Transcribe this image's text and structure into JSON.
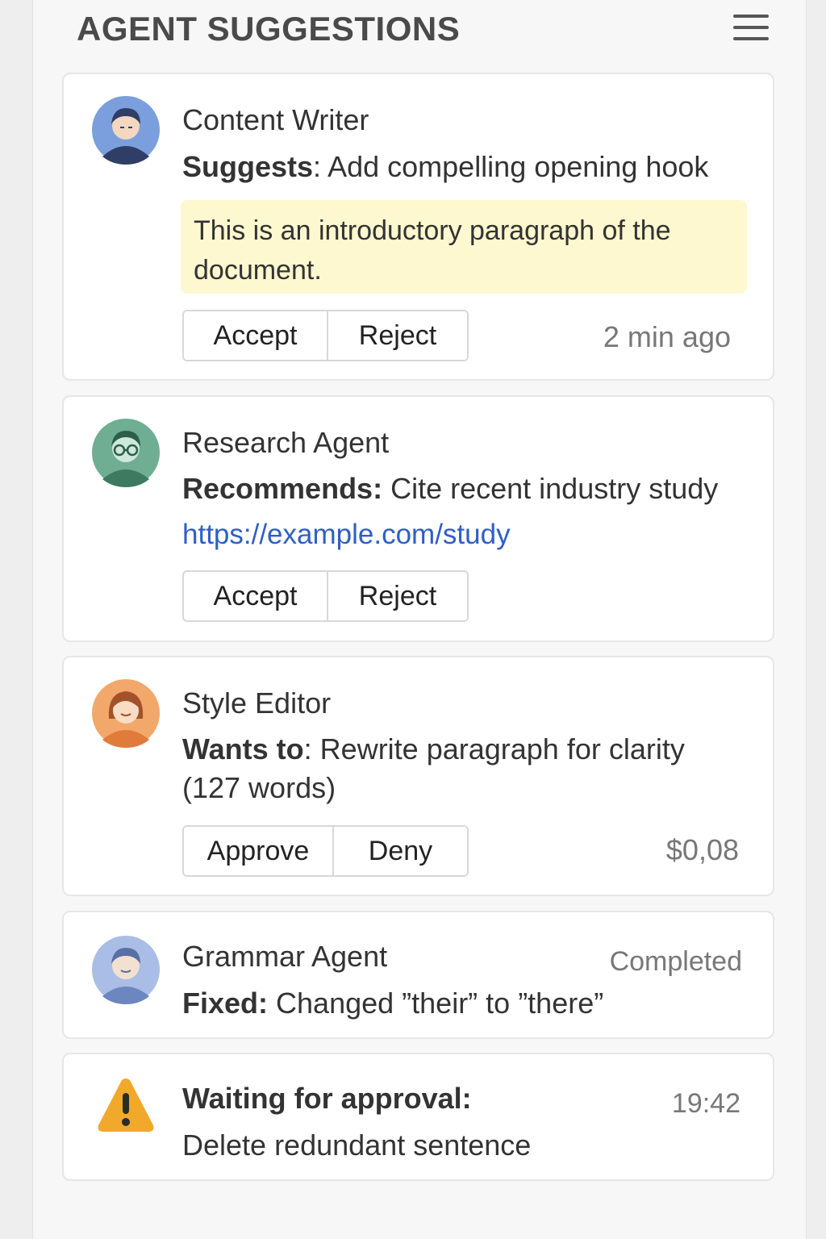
{
  "header": {
    "title": "AGENT SUGGESTIONS",
    "menu_icon": "hamburger-menu-icon"
  },
  "cards": [
    {
      "agent": "Content Writer",
      "avatar_color": "#7b9fdc",
      "action_label": "Suggests",
      "action_separator": ": ",
      "action_text": "Add compelling opening hook",
      "quote": "This is an introductory paragraph of the document.",
      "buttons": [
        "Accept",
        "Reject"
      ],
      "meta": "2 min ago"
    },
    {
      "agent": "Research Agent",
      "avatar_color": "#6fae92",
      "action_label": "Recommends:",
      "action_separator": " ",
      "action_text": "Cite recent industry study",
      "link": "https://example.com/study",
      "buttons": [
        "Accept",
        "Reject"
      ]
    },
    {
      "agent": "Style Editor",
      "avatar_color": "#f2a86a",
      "action_label": "Wants to",
      "action_separator": ": ",
      "action_text": "Rewrite paragraph for clarity",
      "action_text_line2": "(127 words)",
      "buttons": [
        "Approve",
        "Deny"
      ],
      "meta": "$0,08"
    },
    {
      "agent": "Grammar Agent",
      "avatar_color": "#a9bde6",
      "action_label": "Fixed:",
      "action_separator": " ",
      "action_text": "Changed ”their” to ”there”",
      "status": "Completed"
    },
    {
      "agent": "Waiting for approval:",
      "icon": "warning-icon",
      "icon_color": "#f0a92a",
      "action_text": "Delete redundant sentence",
      "time": "19:42"
    }
  ]
}
